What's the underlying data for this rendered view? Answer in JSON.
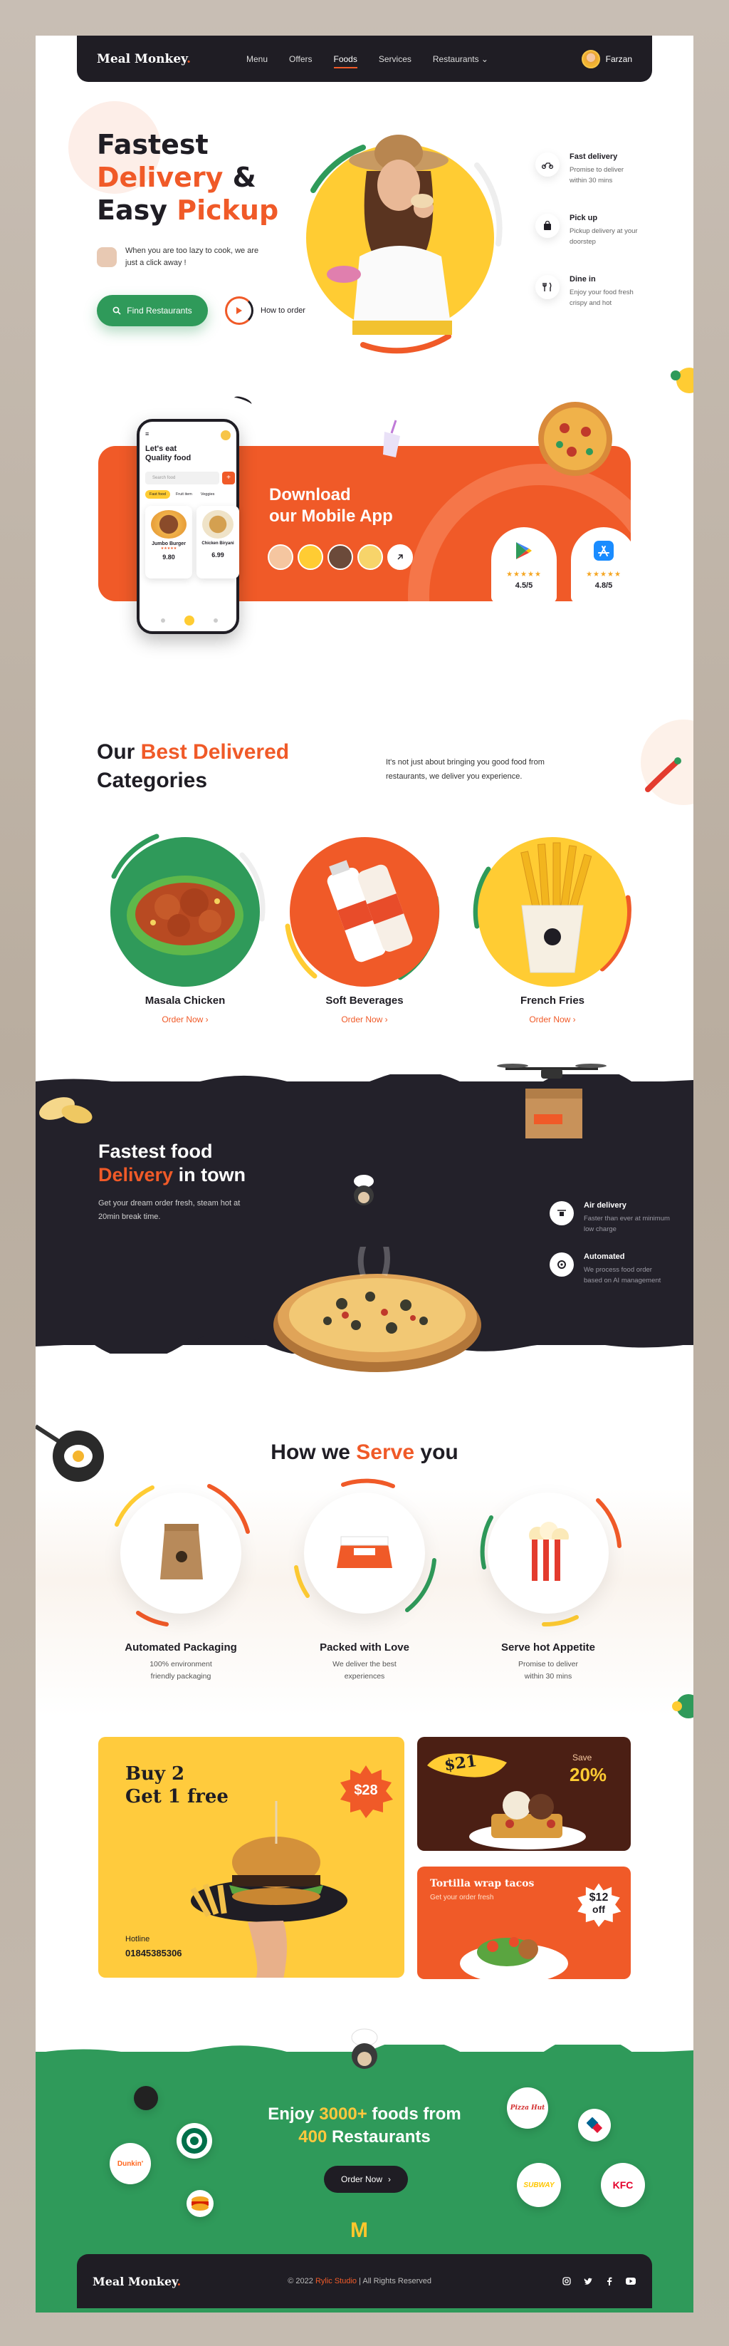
{
  "nav": {
    "logo": "Meal Monkey",
    "logo_dot": ".",
    "items": [
      "Menu",
      "Offers",
      "Foods",
      "Services",
      "Restaurants"
    ],
    "active": "Foods",
    "restaurants_caret": "⌄",
    "user_name": "Farzan"
  },
  "hero": {
    "line1": "Fastest",
    "line2a": "Delivery",
    "line2b": " &",
    "line3a": "Easy ",
    "line3b": "Pickup",
    "tagline": "When you are too lazy to cook, we are just a click away !",
    "cta": "Find Restaurants",
    "how_to": "How to order",
    "features": [
      {
        "icon": "scooter-icon",
        "title": "Fast delivery",
        "desc": "Promise to deliver within 30 mins"
      },
      {
        "icon": "shopping-bag-icon",
        "title": "Pick up",
        "desc": "Pickup delivery at your doorstep"
      },
      {
        "icon": "cutlery-icon",
        "title": "Dine in",
        "desc": "Enjoy your food fresh crispy and hot"
      }
    ]
  },
  "download": {
    "line1": "Download",
    "line2": "our Mobile App",
    "phone": {
      "title1": "Let's eat",
      "title2": "Quality food",
      "search": "Search food",
      "chips": [
        "Fast food",
        "Fruit item",
        "Veggies"
      ],
      "card1_name": "Jumbo Burger",
      "card1_price": "9.80",
      "card2_name": "Chicken Biryani",
      "card2_price": "6.99"
    },
    "google_rating": "4.5/5",
    "apple_rating": "4.8/5",
    "stars": "★★★★★"
  },
  "categories": {
    "title1": "Our ",
    "title_accent": "Best Delivered",
    "title2": "Categories",
    "desc": "It's not just about bringing you good food from restaurants, we deliver you experience.",
    "items": [
      {
        "name": "Masala Chicken",
        "link": "Order Now"
      },
      {
        "name": "Soft Beverages",
        "link": "Order Now"
      },
      {
        "name": "French Fries",
        "link": "Order Now"
      }
    ],
    "link_arrow": "›"
  },
  "fastest": {
    "line1": "Fastest food",
    "line2a": "Delivery",
    "line2b": " in town",
    "desc": "Get your dream order fresh, steam hot at 20min break time.",
    "features": [
      {
        "icon": "drone-icon",
        "title": "Air delivery",
        "desc": "Faster than ever at minimum low charge"
      },
      {
        "icon": "ai-gear-icon",
        "title": "Automated",
        "desc": "We process food order based on AI management"
      }
    ]
  },
  "serve": {
    "title_a": "How we ",
    "title_b": "Serve",
    "title_c": " you",
    "items": [
      {
        "name": "Automated Packaging",
        "desc": "100% environment friendly packaging"
      },
      {
        "name": "Packed with Love",
        "desc": "We deliver the best experiences"
      },
      {
        "name": "Serve hot Appetite",
        "desc": "Promise to deliver within 30 mins"
      }
    ]
  },
  "promos": {
    "buy_line1": "Buy 2",
    "buy_line2": "Get 1 free",
    "buy_price": "$28",
    "hotline_label": "Hotline",
    "hotline_number": "01845385306",
    "waffle_price": "$21",
    "waffle_save_label": "Save",
    "waffle_save_value": "20%",
    "tacos_title": "Tortilla wrap tacos",
    "tacos_sub": "Get your order fresh",
    "tacos_price": "$12",
    "tacos_off": "off"
  },
  "restaurants": {
    "line1a": "Enjoy ",
    "line1b": "3000+",
    "line1c": " foods from",
    "line2a": "400",
    "line2b": " Restaurants",
    "cta": "Order Now",
    "cta_arrow": "›",
    "brands": [
      "Pizza Hut",
      "Domino's",
      "SUBWAY",
      "KFC",
      "Starbucks",
      "Dunkin'",
      "Burger King",
      "M"
    ]
  },
  "footer": {
    "logo": "Meal Monkey",
    "logo_dot": ".",
    "copyright": "© 2022 ",
    "studio": "Rylic Studio",
    "rights": " | All Rights Reserved",
    "socials": [
      "instagram-icon",
      "twitter-icon",
      "facebook-icon",
      "youtube-icon"
    ]
  },
  "colors": {
    "orange": "#f05a28",
    "green": "#2f9a5a",
    "dark": "#1f1d24",
    "yellow": "#ffcc33"
  }
}
